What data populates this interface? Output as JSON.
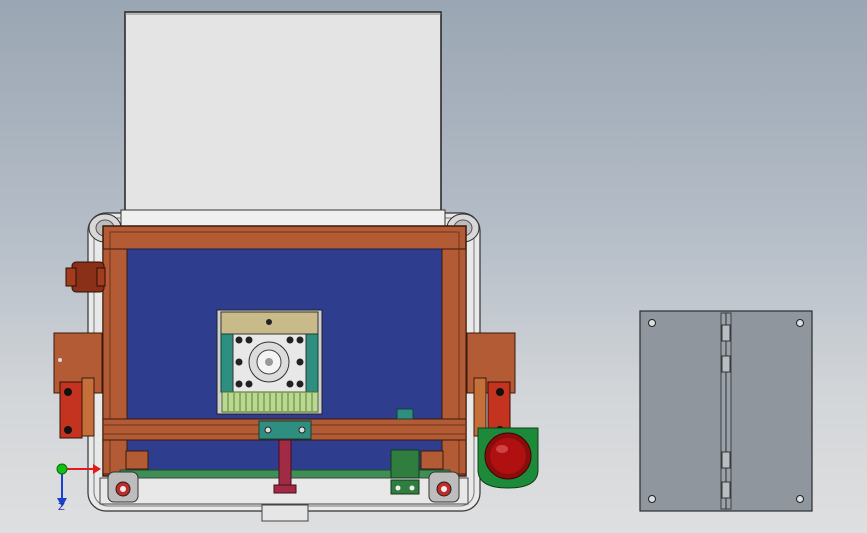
{
  "window": {
    "title": ""
  },
  "triad": {
    "axis_z_label": "Z",
    "axis_y_color": "#11c011",
    "axis_x_color": "#e01b1b",
    "axis_z_color": "#1b3fd0"
  },
  "colors": {
    "background_top": "#9aa6b3",
    "background_bottom": "#dedfe0",
    "hopper": "#e4e4e4",
    "frame": "#b25b35",
    "frame_dark": "#6f351c",
    "panel_blue": "#2e3d8e",
    "motor_teal": "#2e8f80",
    "motor_green": "#b9d890",
    "red_knob": "#b01010",
    "green_housing": "#1d8a3a",
    "steel_plate": "#8f969d"
  },
  "icons": {
    "triad": "coordinate-triad-icon"
  }
}
